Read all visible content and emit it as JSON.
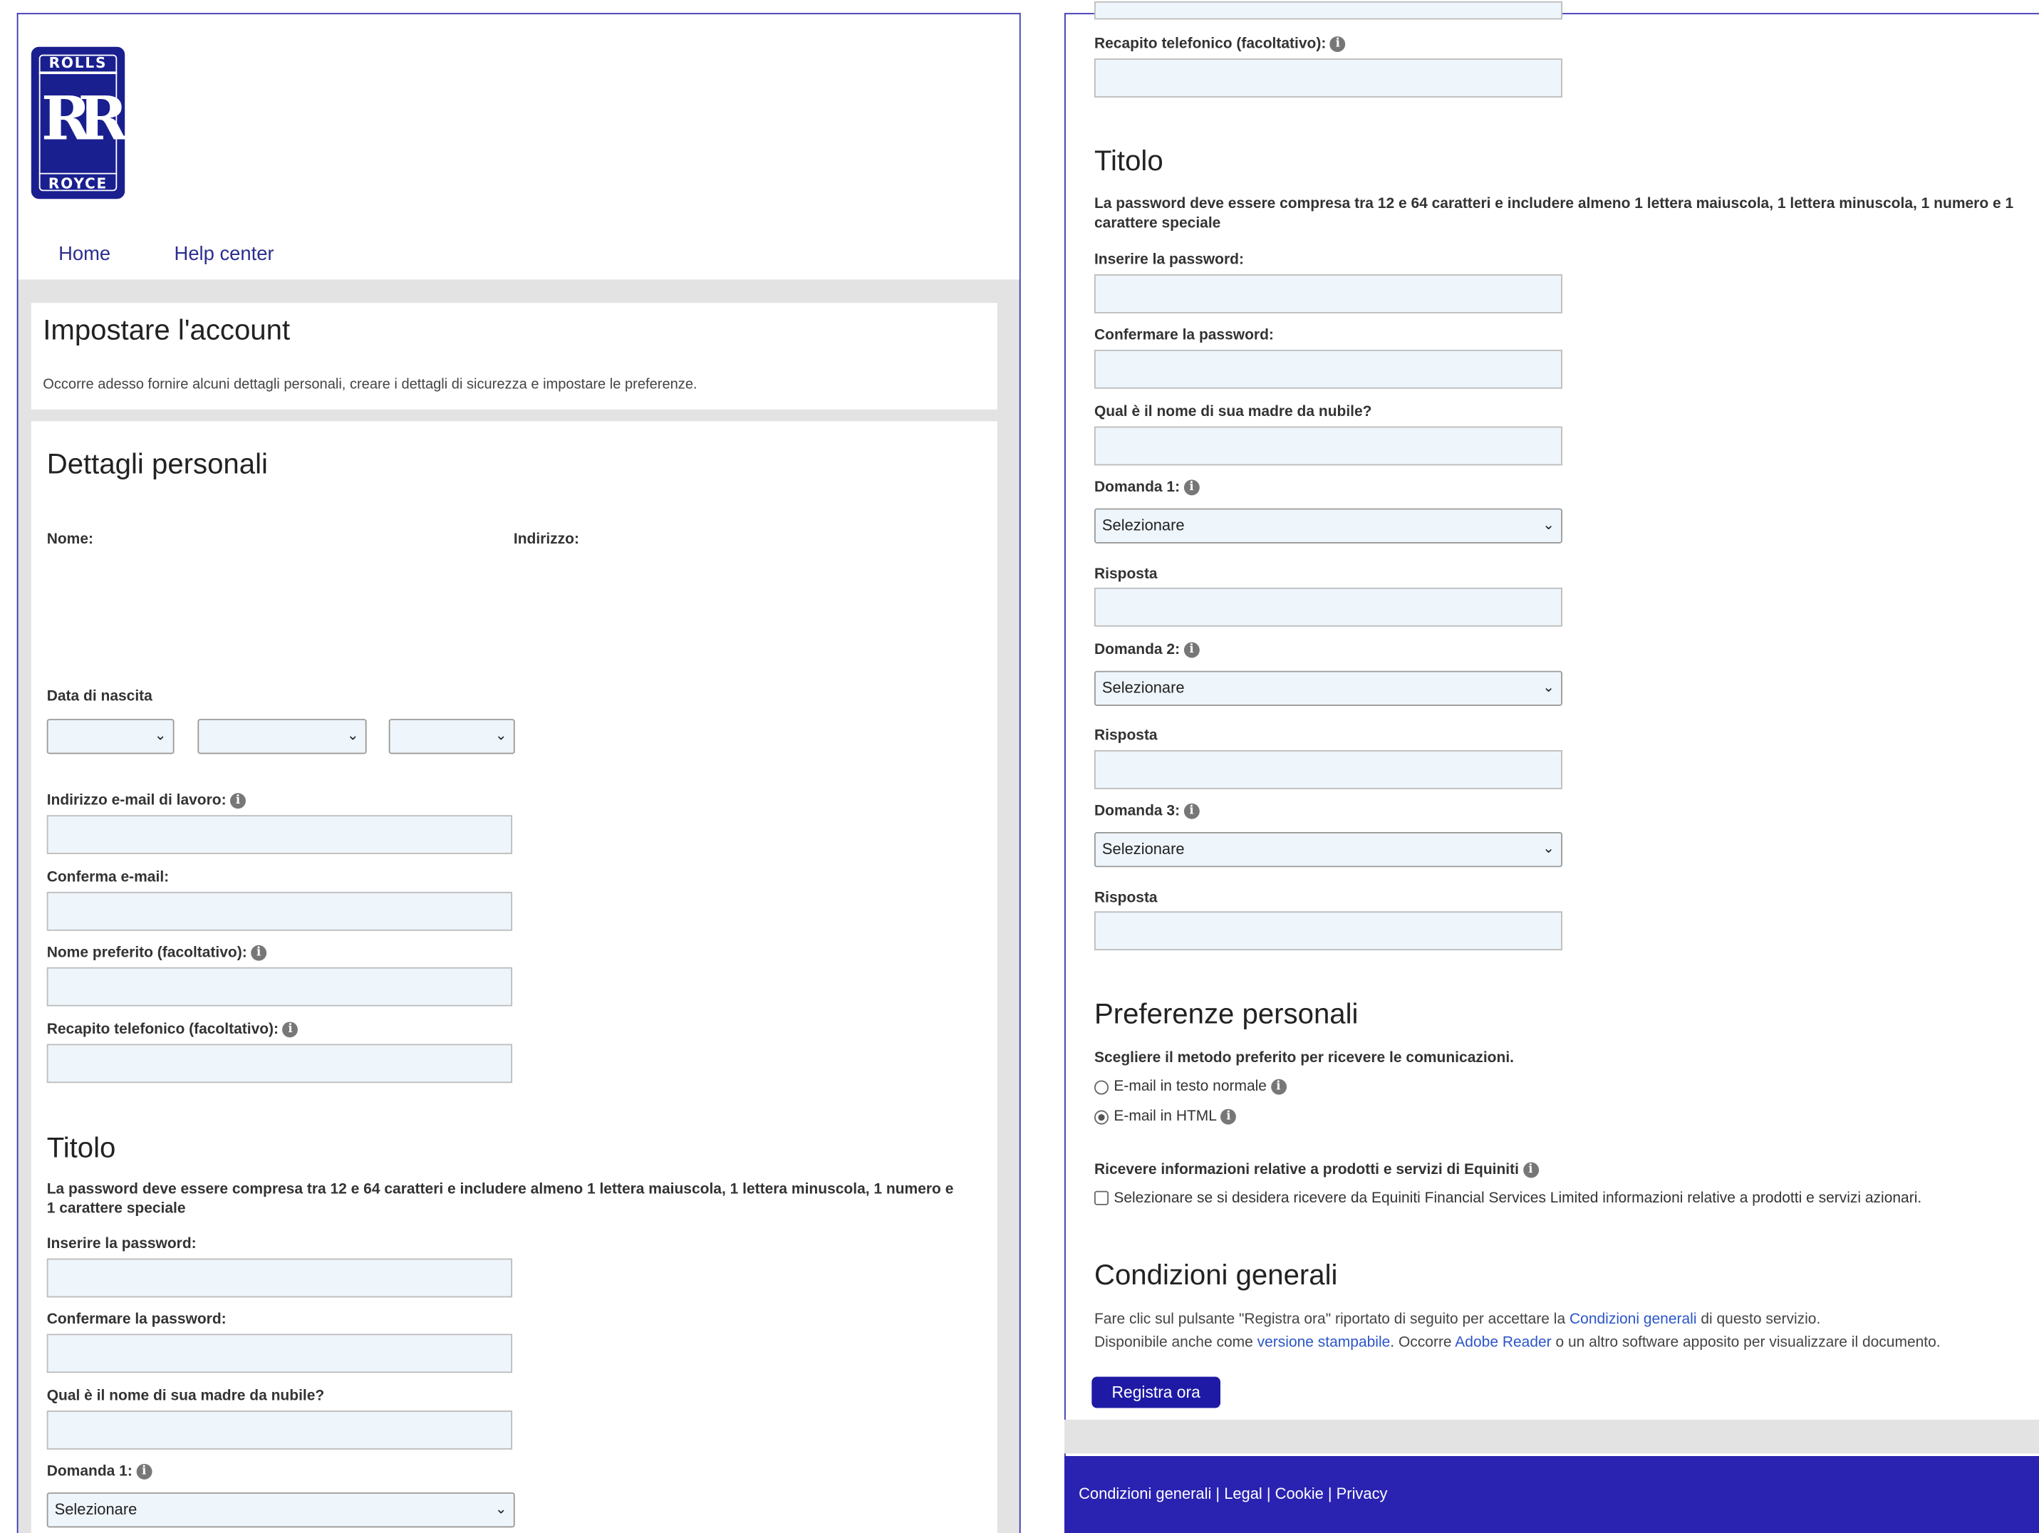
{
  "logo": {
    "top_text": "ROLLS",
    "mark": "RR",
    "bottom_text": "ROYCE"
  },
  "nav": {
    "home": "Home",
    "help": "Help center"
  },
  "setup": {
    "title": "Impostare l'account",
    "desc": "Occorre adesso fornire alcuni dettagli personali, creare i dettagli di sicurezza e impostare le preferenze."
  },
  "personal": {
    "title": "Dettagli personali",
    "name_label": "Nome:",
    "address_label": "Indirizzo:",
    "dob_label": "Data di nascita",
    "email_label": "Indirizzo e-mail di lavoro:",
    "confirm_email_label": "Conferma e-mail:",
    "preferred_name_label": "Nome preferito (facoltativo):",
    "phone_label": "Recapito telefonico (facoltativo):"
  },
  "security": {
    "title": "Titolo",
    "rule": "La password deve essere compresa tra 12 e 64 caratteri e includere almeno 1 lettera maiuscola, 1 lettera minuscola, 1 numero e 1 carattere speciale",
    "password_label": "Inserire la password:",
    "confirm_password_label": "Confermare la password:",
    "maiden_label": "Qual è il nome di sua madre da nubile?",
    "q1_label": "Domanda 1:",
    "q2_label": "Domanda 2:",
    "q3_label": "Domanda 3:",
    "answer_label": "Risposta",
    "select_value": "Selezionare"
  },
  "preferences": {
    "title": "Preferenze personali",
    "method_label": "Scegliere il metodo preferito per ricevere le comunicazioni.",
    "opt_plain": "E-mail in testo normale",
    "opt_html": "E-mail in HTML",
    "selected": "E-mail in HTML",
    "info_label": "Ricevere informazioni relative a prodotti e servizi di Equiniti",
    "checkbox_text": "Selezionare se si desidera ricevere da Equiniti Financial Services Limited informazioni relative a prodotti e servizi azionari."
  },
  "terms": {
    "title": "Condizioni generali",
    "l1_a": "Fare clic sul pulsante \"Registra ora\" riportato di seguito per accettare la ",
    "l1_link": "Condizioni generali",
    "l1_b": " di questo servizio.",
    "l2_a": "Disponibile anche come ",
    "l2_link1": "versione stampabile",
    "l2_b": ". Occorre ",
    "l2_link2": "Adobe Reader",
    "l2_c": " o un altro software apposito per visualizzare il documento.",
    "button": "Registra ora"
  },
  "icons": {
    "info": "info-icon",
    "chevron": "chevron-down-icon"
  },
  "colors": {
    "brand": "#1a1f8f",
    "footer": "#2a22b0",
    "link": "#2b55c9",
    "input_bg": "#eef5fb"
  },
  "footer": {
    "links": "Condizioni generali | Legal | Cookie | Privacy"
  }
}
